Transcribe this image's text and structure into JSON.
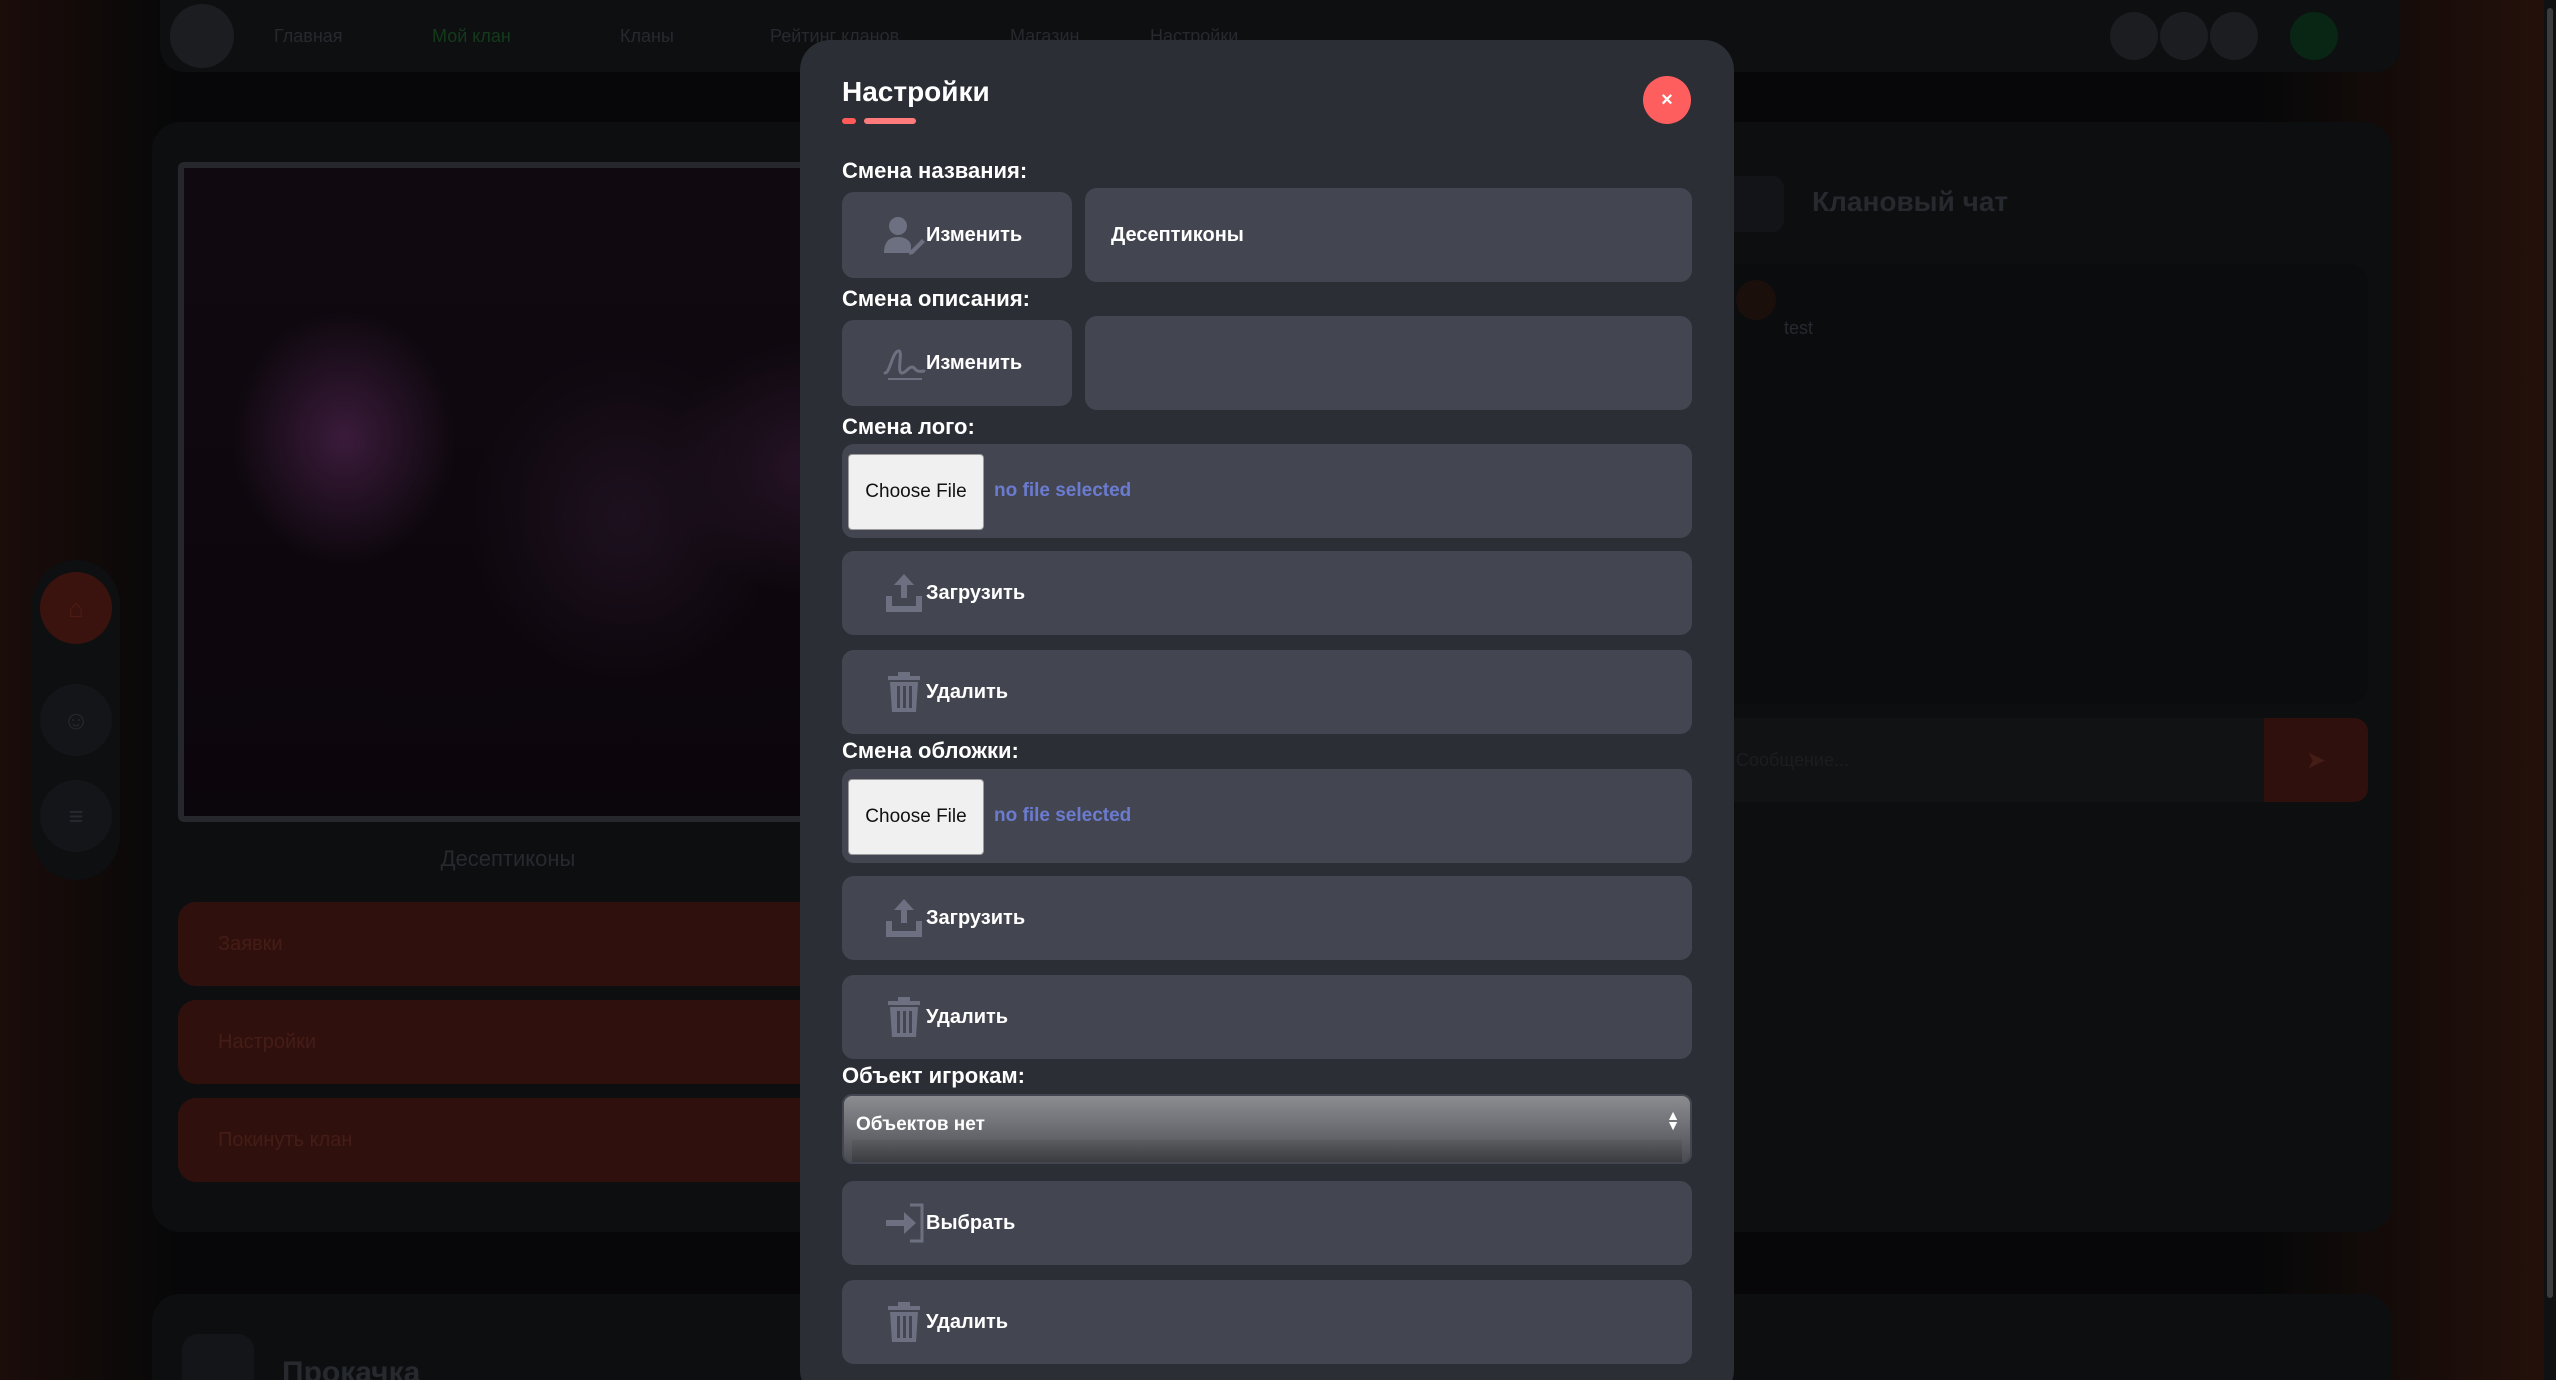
{
  "background": {
    "nav_items": [
      "Главная",
      "Мой клан",
      "Кланы",
      "Рейтинг кланов",
      "Магазин",
      "Настройки"
    ],
    "clan_name": "Десептиконы",
    "actions": [
      "Заявки",
      "Настройки",
      "Покинуть клан"
    ],
    "chat_title": "Клановый чат",
    "chat_message": {
      "author": "",
      "time": "",
      "text": "test"
    },
    "chat_input_placeholder": "Сообщение...",
    "bottom_title": "Прокачка"
  },
  "modal": {
    "title": "Настройки",
    "close_symbol": "×",
    "name_section": {
      "label": "Смена названия:",
      "button_label": "Изменить",
      "button_icon": "user-edit-icon",
      "value": "Десептиконы"
    },
    "description_section": {
      "label": "Смена описания:",
      "button_label": "Изменить",
      "button_icon": "signature-icon",
      "value": ""
    },
    "logo_section": {
      "label": "Смена лого:",
      "choose_file_label": "Choose File",
      "file_status": "no file selected",
      "upload_label": "Загрузить",
      "delete_label": "Удалить"
    },
    "cover_section": {
      "label": "Смена обложки:",
      "choose_file_label": "Choose File",
      "file_status": "no file selected",
      "upload_label": "Загрузить",
      "delete_label": "Удалить"
    },
    "object_section": {
      "label": "Объект игрокам:",
      "selected_option": "Объектов нет",
      "select_label": "Выбрать",
      "delete_label": "Удалить"
    }
  },
  "colors": {
    "modal_bg": "#2b2e35",
    "control_bg": "#434650",
    "close_button": "#ff5e5e",
    "accent": "#ff7a7a",
    "file_status_text": "#6a7bd0"
  }
}
